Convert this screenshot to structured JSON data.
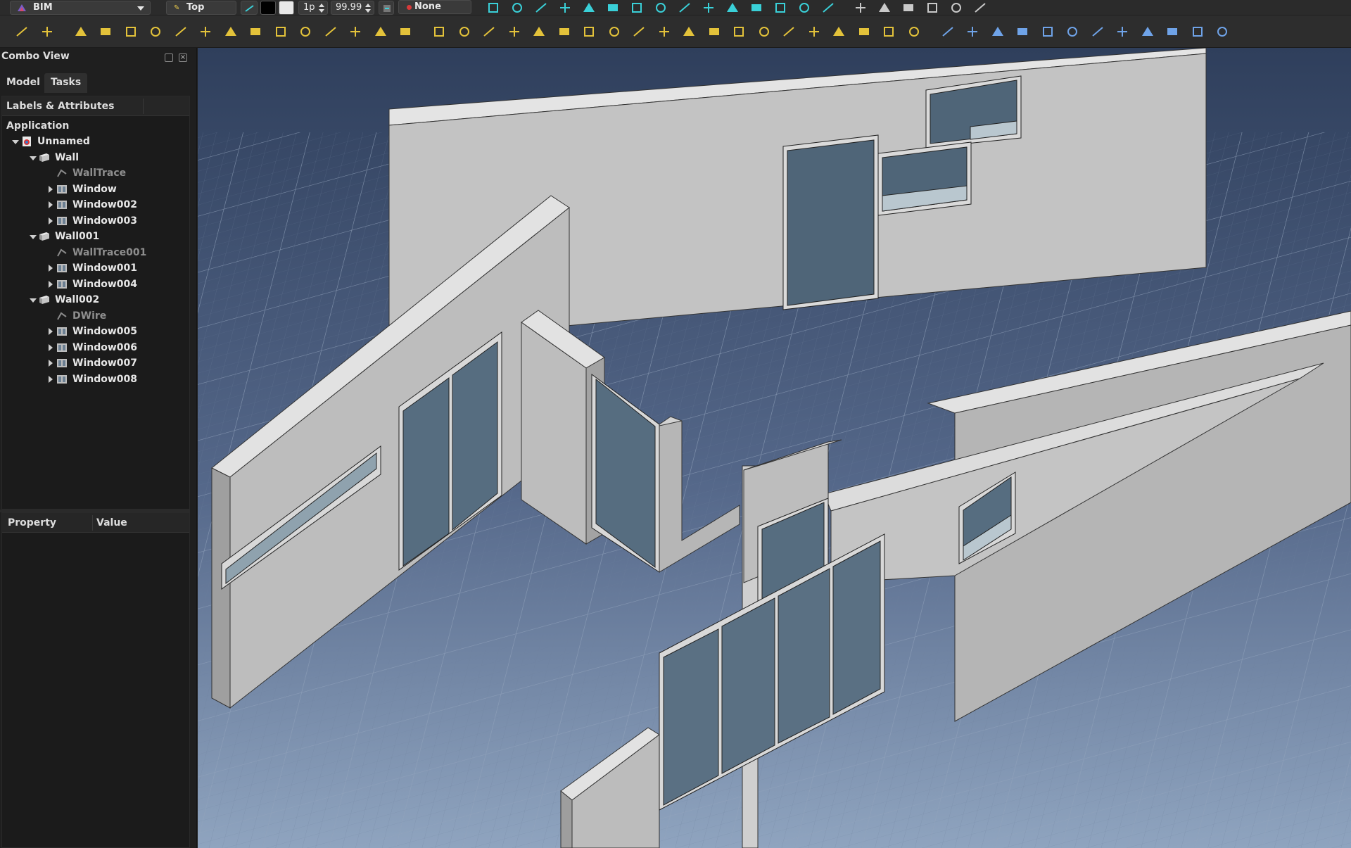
{
  "toolbar": {
    "workbench": "BIM",
    "working_plane": "Top",
    "line_width": "1p",
    "font_size": "99.99",
    "style": "None",
    "icons_row1": [
      "grid-icon",
      "lock-icon",
      "snap-endpoint-icon",
      "snap-extension-icon",
      "snap-parallel-icon",
      "snap-grid-icon",
      "snap-near-icon",
      "snap-perpendicular-icon",
      "snap-center-icon",
      "snap-circle-icon",
      "snap-plus-icon",
      "snap-intersection-icon",
      "snap-special-icon",
      "snap-dimensions-icon",
      "working-plane-icon",
      "cross-icon",
      "building-part-icon",
      "wall-icon",
      "stairs-icon",
      "material-icon",
      "sheet-icon"
    ],
    "icons_row2": [
      "project-icon",
      "folder-icon",
      "line-icon",
      "wire-icon",
      "circle-icon",
      "arc-icon",
      "bspline-icon",
      "polygon-icon",
      "rectangle-icon",
      "bezier-icon",
      "fillet-icon",
      "point-icon",
      "text-icon",
      "shapestring-icon",
      "dimension-icon",
      "label-icon",
      "wall-icon",
      "structure-icon",
      "line-dim-icon",
      "remove-icon",
      "roof-icon",
      "panel-icon",
      "frame-icon",
      "stairs-icon",
      "pipe-icon",
      "space-icon",
      "equipment-icon",
      "axis-icon",
      "grid-icon",
      "fence-icon",
      "truss-icon",
      "profile-icon",
      "schedule-icon",
      "material-icon",
      "component-icon",
      "section-icon",
      "move-icon",
      "rotate-icon",
      "offset-icon",
      "trim-icon",
      "scale-icon",
      "mirror-icon",
      "array-icon",
      "clone-icon",
      "draft2sketch-icon",
      "upgrade-icon",
      "downgrade-icon",
      "measure-icon"
    ],
    "colors": {
      "accent_yellow": "#e3c23a",
      "accent_cyan": "#3ad0d8"
    }
  },
  "combo": {
    "title": "Combo View",
    "tabs": [
      "Model",
      "Tasks"
    ],
    "labels_header": "Labels & Attributes",
    "application": "Application",
    "tree": [
      {
        "label": "Unnamed",
        "level": 0,
        "twisty": "open",
        "icon": "document-icon",
        "dim": false
      },
      {
        "label": "Wall",
        "level": 1,
        "twisty": "open",
        "icon": "wall-icon",
        "dim": false
      },
      {
        "label": "WallTrace",
        "level": 2,
        "twisty": "none",
        "icon": "wire-icon",
        "dim": true
      },
      {
        "label": "Window",
        "level": 2,
        "twisty": "closed",
        "icon": "window-icon",
        "dim": false
      },
      {
        "label": "Window002",
        "level": 2,
        "twisty": "closed",
        "icon": "window-icon",
        "dim": false
      },
      {
        "label": "Window003",
        "level": 2,
        "twisty": "closed",
        "icon": "window-icon",
        "dim": false
      },
      {
        "label": "Wall001",
        "level": 1,
        "twisty": "open",
        "icon": "wall-icon",
        "dim": false
      },
      {
        "label": "WallTrace001",
        "level": 2,
        "twisty": "none",
        "icon": "wire-icon",
        "dim": true
      },
      {
        "label": "Window001",
        "level": 2,
        "twisty": "closed",
        "icon": "window-icon",
        "dim": false
      },
      {
        "label": "Window004",
        "level": 2,
        "twisty": "closed",
        "icon": "window-icon",
        "dim": false
      },
      {
        "label": "Wall002",
        "level": 1,
        "twisty": "open",
        "icon": "wall-icon",
        "dim": false
      },
      {
        "label": "DWire",
        "level": 2,
        "twisty": "none",
        "icon": "wire-icon",
        "dim": true
      },
      {
        "label": "Window005",
        "level": 2,
        "twisty": "closed",
        "icon": "window-icon",
        "dim": false
      },
      {
        "label": "Window006",
        "level": 2,
        "twisty": "closed",
        "icon": "window-icon",
        "dim": false
      },
      {
        "label": "Window007",
        "level": 2,
        "twisty": "closed",
        "icon": "window-icon",
        "dim": false
      },
      {
        "label": "Window008",
        "level": 2,
        "twisty": "closed",
        "icon": "window-icon",
        "dim": false
      }
    ],
    "property_header": "Property",
    "value_header": "Value"
  },
  "viewport": {
    "background_top": "#2f3f5c",
    "background_bottom": "#8fa4bf",
    "wall_light": "#dcdcdc",
    "wall_mid": "#b9b9b9",
    "wall_dark": "#9c9c9c",
    "glass": "#4f6578"
  }
}
